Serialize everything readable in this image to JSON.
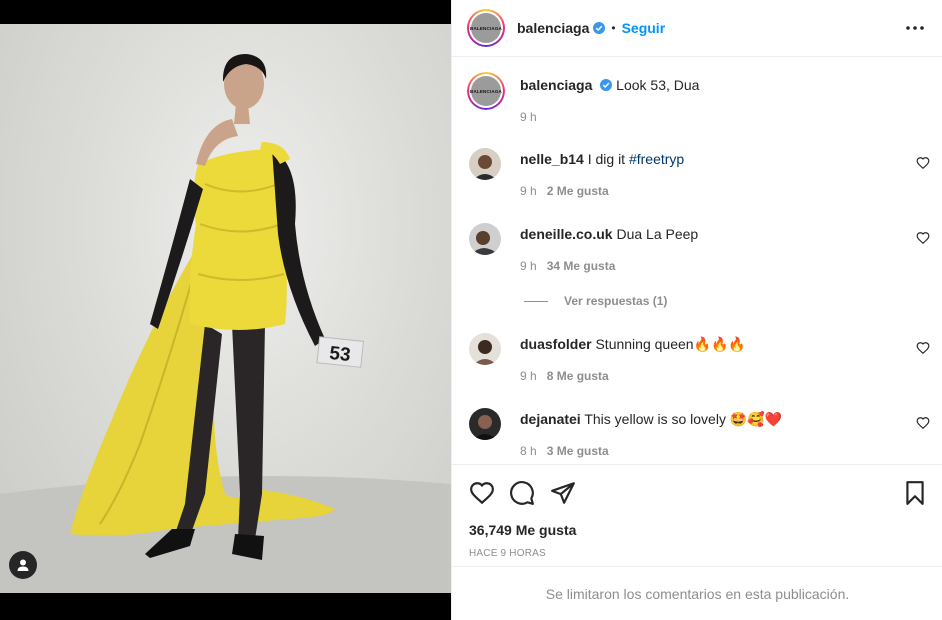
{
  "post": {
    "username": "balenciaga",
    "follow_label": "Seguir",
    "separator": "•",
    "avatar_text": "BALENCIAGA",
    "photo_tag_number": "53"
  },
  "caption": {
    "username": "balenciaga",
    "text": "Look 53, Dua",
    "time": "9 h"
  },
  "comments": [
    {
      "username": "nelle_b14",
      "text": "I dig it ",
      "hashtag": "#freetryp",
      "time": "9 h",
      "likes": "2 Me gusta"
    },
    {
      "username": "deneille.co.uk",
      "text": "Dua La Peep",
      "time": "9 h",
      "likes": "34 Me gusta"
    },
    {
      "username": "duasfolder",
      "text": "Stunning queen🔥🔥🔥",
      "time": "9 h",
      "likes": "8 Me gusta"
    },
    {
      "username": "dejanatei",
      "text": "This yellow is so lovely 🤩🥰❤️",
      "time": "8 h",
      "likes": "3 Me gusta"
    }
  ],
  "replies_label": "Ver respuestas (1)",
  "footer": {
    "likes": "36,749 Me gusta",
    "time_ago": "HACE 9 HORAS",
    "comments_limited": "Se limitaron los comentarios en esta publicación."
  },
  "colors": {
    "accent": "#0095f6",
    "text": "#262626",
    "muted": "#8e8e8e",
    "dress": "#ecd93a",
    "verified": "#3897f0"
  }
}
